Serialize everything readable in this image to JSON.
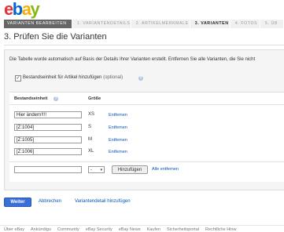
{
  "logo": {
    "letters": [
      "e",
      "b",
      "a",
      "y"
    ],
    "colors": [
      "#e53238",
      "#0064d2",
      "#f5af02",
      "#86b817"
    ]
  },
  "steps": [
    "Varianten bearbeiten",
    "1. Variantendetails",
    "2. Artikelmerkmale",
    "3. Varianten",
    "4. Fotos",
    "5. Üb"
  ],
  "page": {
    "title": "3. Prüfen Sie die Varianten",
    "intro": "Die Tabelle wurde automatisch auf Basis der Details Ihrer Varianten erstellt. Entfernen Sie alle Varianten, die Sie nicht",
    "checkbox_label": "Bestandseinheit für Artikel hinzufügen",
    "checkbox_optional": "(optional)",
    "checkbox_checked": true
  },
  "table": {
    "headers": {
      "sku": "Bestandseinheit",
      "size": "Größe"
    },
    "rows": [
      {
        "sku": "Hier ändern!!!!",
        "size": "XS",
        "action": "Entfernen"
      },
      {
        "sku": "[Z:1004]",
        "size": "S",
        "action": "Entfernen"
      },
      {
        "sku": "[Z:1005]",
        "size": "M",
        "action": "Entfernen"
      },
      {
        "sku": "[Z:1006]",
        "size": "XL",
        "action": "Entfernen"
      }
    ],
    "new_row": {
      "sku_value": "",
      "size_value": "-",
      "add_button": "Hinzufügen",
      "remove_all": "Alle entfernen"
    }
  },
  "actions": {
    "continue": "Weiter",
    "cancel": "Abbrechen",
    "add_detail": "Variantendetail hinzufügen"
  },
  "footer": [
    "Über eBay",
    "Ankündigu",
    "Community",
    "eBay Security",
    "eBay News",
    "Kaufen",
    "Sicherheitsportal",
    "Rechtliche Hinw"
  ],
  "colors": {
    "primary_button": "#3a6fd8",
    "link": "#0654ba",
    "help_icon": "#b8c3e3"
  }
}
